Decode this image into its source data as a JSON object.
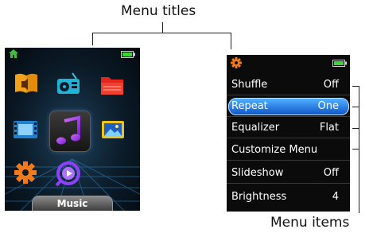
{
  "annotations": {
    "menu_titles": "Menu titles",
    "menu_items": "Menu items"
  },
  "home_screen": {
    "label": "Music",
    "icons": [
      "audiobooks-icon",
      "radio-icon",
      "folder-icon",
      "video-icon",
      "music-icon",
      "photo-icon",
      "settings-icon",
      "podcast-icon"
    ],
    "status_icons": [
      "home-icon",
      "battery-icon"
    ]
  },
  "menu_screen": {
    "status_icons": [
      "settings-icon",
      "battery-icon"
    ],
    "items": [
      {
        "label": "Shuffle",
        "value": "Off",
        "selected": false
      },
      {
        "label": "Repeat",
        "value": "One",
        "selected": true
      },
      {
        "label": "Equalizer",
        "value": "Flat",
        "selected": false
      },
      {
        "label": "Customize Menu",
        "value": "",
        "selected": false
      },
      {
        "label": "Slideshow",
        "value": "Off",
        "selected": false
      },
      {
        "label": "Brightness",
        "value": "4",
        "selected": false
      }
    ]
  },
  "colors": {
    "selection_blue": "#1e6fe0",
    "home_green": "#3fbf3f",
    "battery_green": "#3fd23f"
  }
}
